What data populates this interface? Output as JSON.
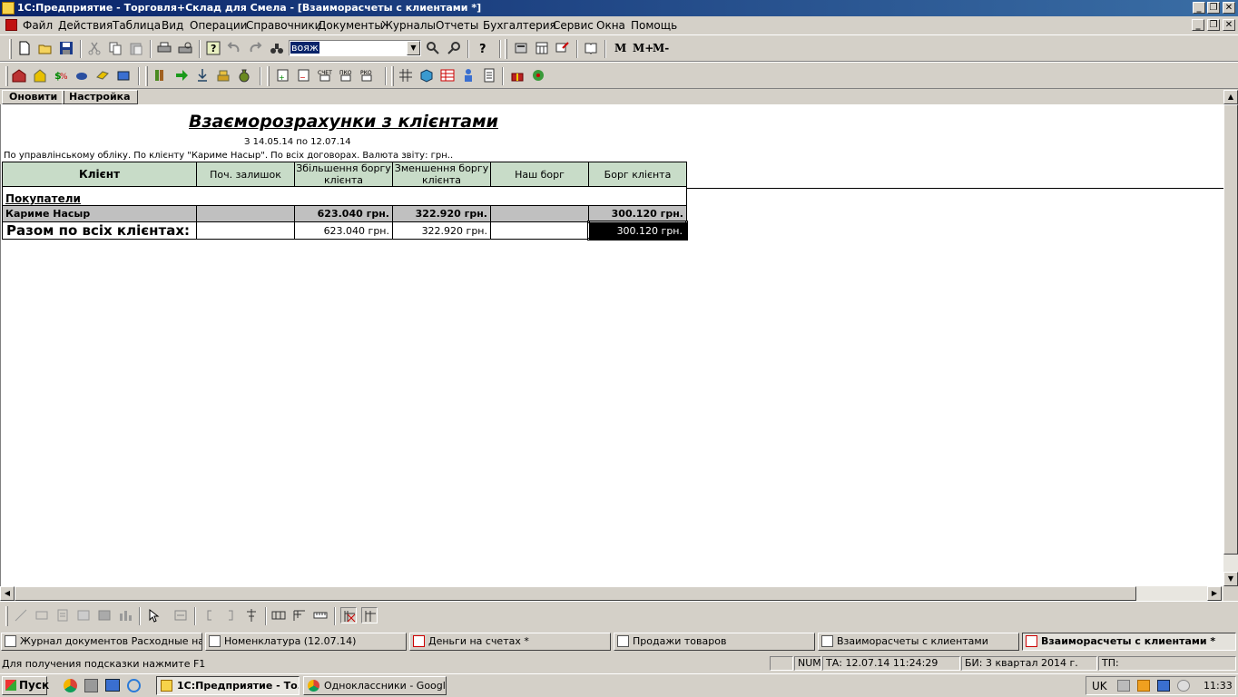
{
  "window": {
    "title": "1С:Предприятие - Торговля+Склад для Смела - [Взаиморасчеты с клиентами *]"
  },
  "menu": [
    "Файл",
    "Действия",
    "Таблица",
    "Вид",
    "Операции",
    "Справочники",
    "Документы",
    "Журналы",
    "Отчеты",
    "Бухгалтерия",
    "Сервис",
    "Окна",
    "Помощь"
  ],
  "toolbar": {
    "search_value": "вояж",
    "m_label": "M",
    "mplus_label": "M+",
    "mminus_label": "M-"
  },
  "report_toolbar": {
    "refresh": "Оновити",
    "settings": "Настройка"
  },
  "report": {
    "title": "Взаєморозрахунки з клієнтами",
    "period": "З 14.05.14 по 12.07.14",
    "params": "По управлінському обліку. По клієнту \"Кариме Насыр\". По всіх договорах.  Валюта звіту: грн..",
    "columns": [
      "Клієнт",
      "Поч. залишок",
      "Збільшення боргу клієнта",
      "Зменшення боргу клієнта",
      "Наш борг",
      "Борг клієнта"
    ],
    "group": "Покупатели",
    "rows": [
      {
        "client": "Кариме Насыр",
        "opening": "",
        "increase": "623.040 грн.",
        "decrease": "322.920 грн.",
        "our_debt": "",
        "client_debt": "300.120 грн."
      }
    ],
    "total": {
      "label": "Разом по всіх клієнтах:",
      "opening": "",
      "increase": "623.040 грн.",
      "decrease": "322.920 грн.",
      "our_debt": "",
      "client_debt": "300.120 грн."
    }
  },
  "window_tabs": [
    {
      "label": "Журнал документов  Расходные накладные",
      "active": false
    },
    {
      "label": "Номенклатура (12.07.14)",
      "active": false
    },
    {
      "label": "Деньги на счетах  *",
      "active": false
    },
    {
      "label": "Продажи товаров",
      "active": false
    },
    {
      "label": "Взаиморасчеты с клиентами",
      "active": false
    },
    {
      "label": "Взаиморасчеты с клиентами  *",
      "active": true
    }
  ],
  "status": {
    "hint": "Для получения подсказки нажмите F1",
    "num": "NUM",
    "ta": "ТА: 12.07.14  11:24:29",
    "bi": "БИ: 3 квартал 2014 г.",
    "tp": "ТП:"
  },
  "taskbar": {
    "start": "Пуск",
    "tasks": [
      {
        "label": "1С:Предприятие - То...",
        "active": true
      },
      {
        "label": "Одноклассники - Googl...",
        "active": false
      }
    ],
    "lang": "UK",
    "clock": "11:33"
  },
  "colors": {
    "header_bg": "#c8dcc8",
    "row_bg": "#c0c0c0",
    "title_bar": "#0a246a"
  }
}
